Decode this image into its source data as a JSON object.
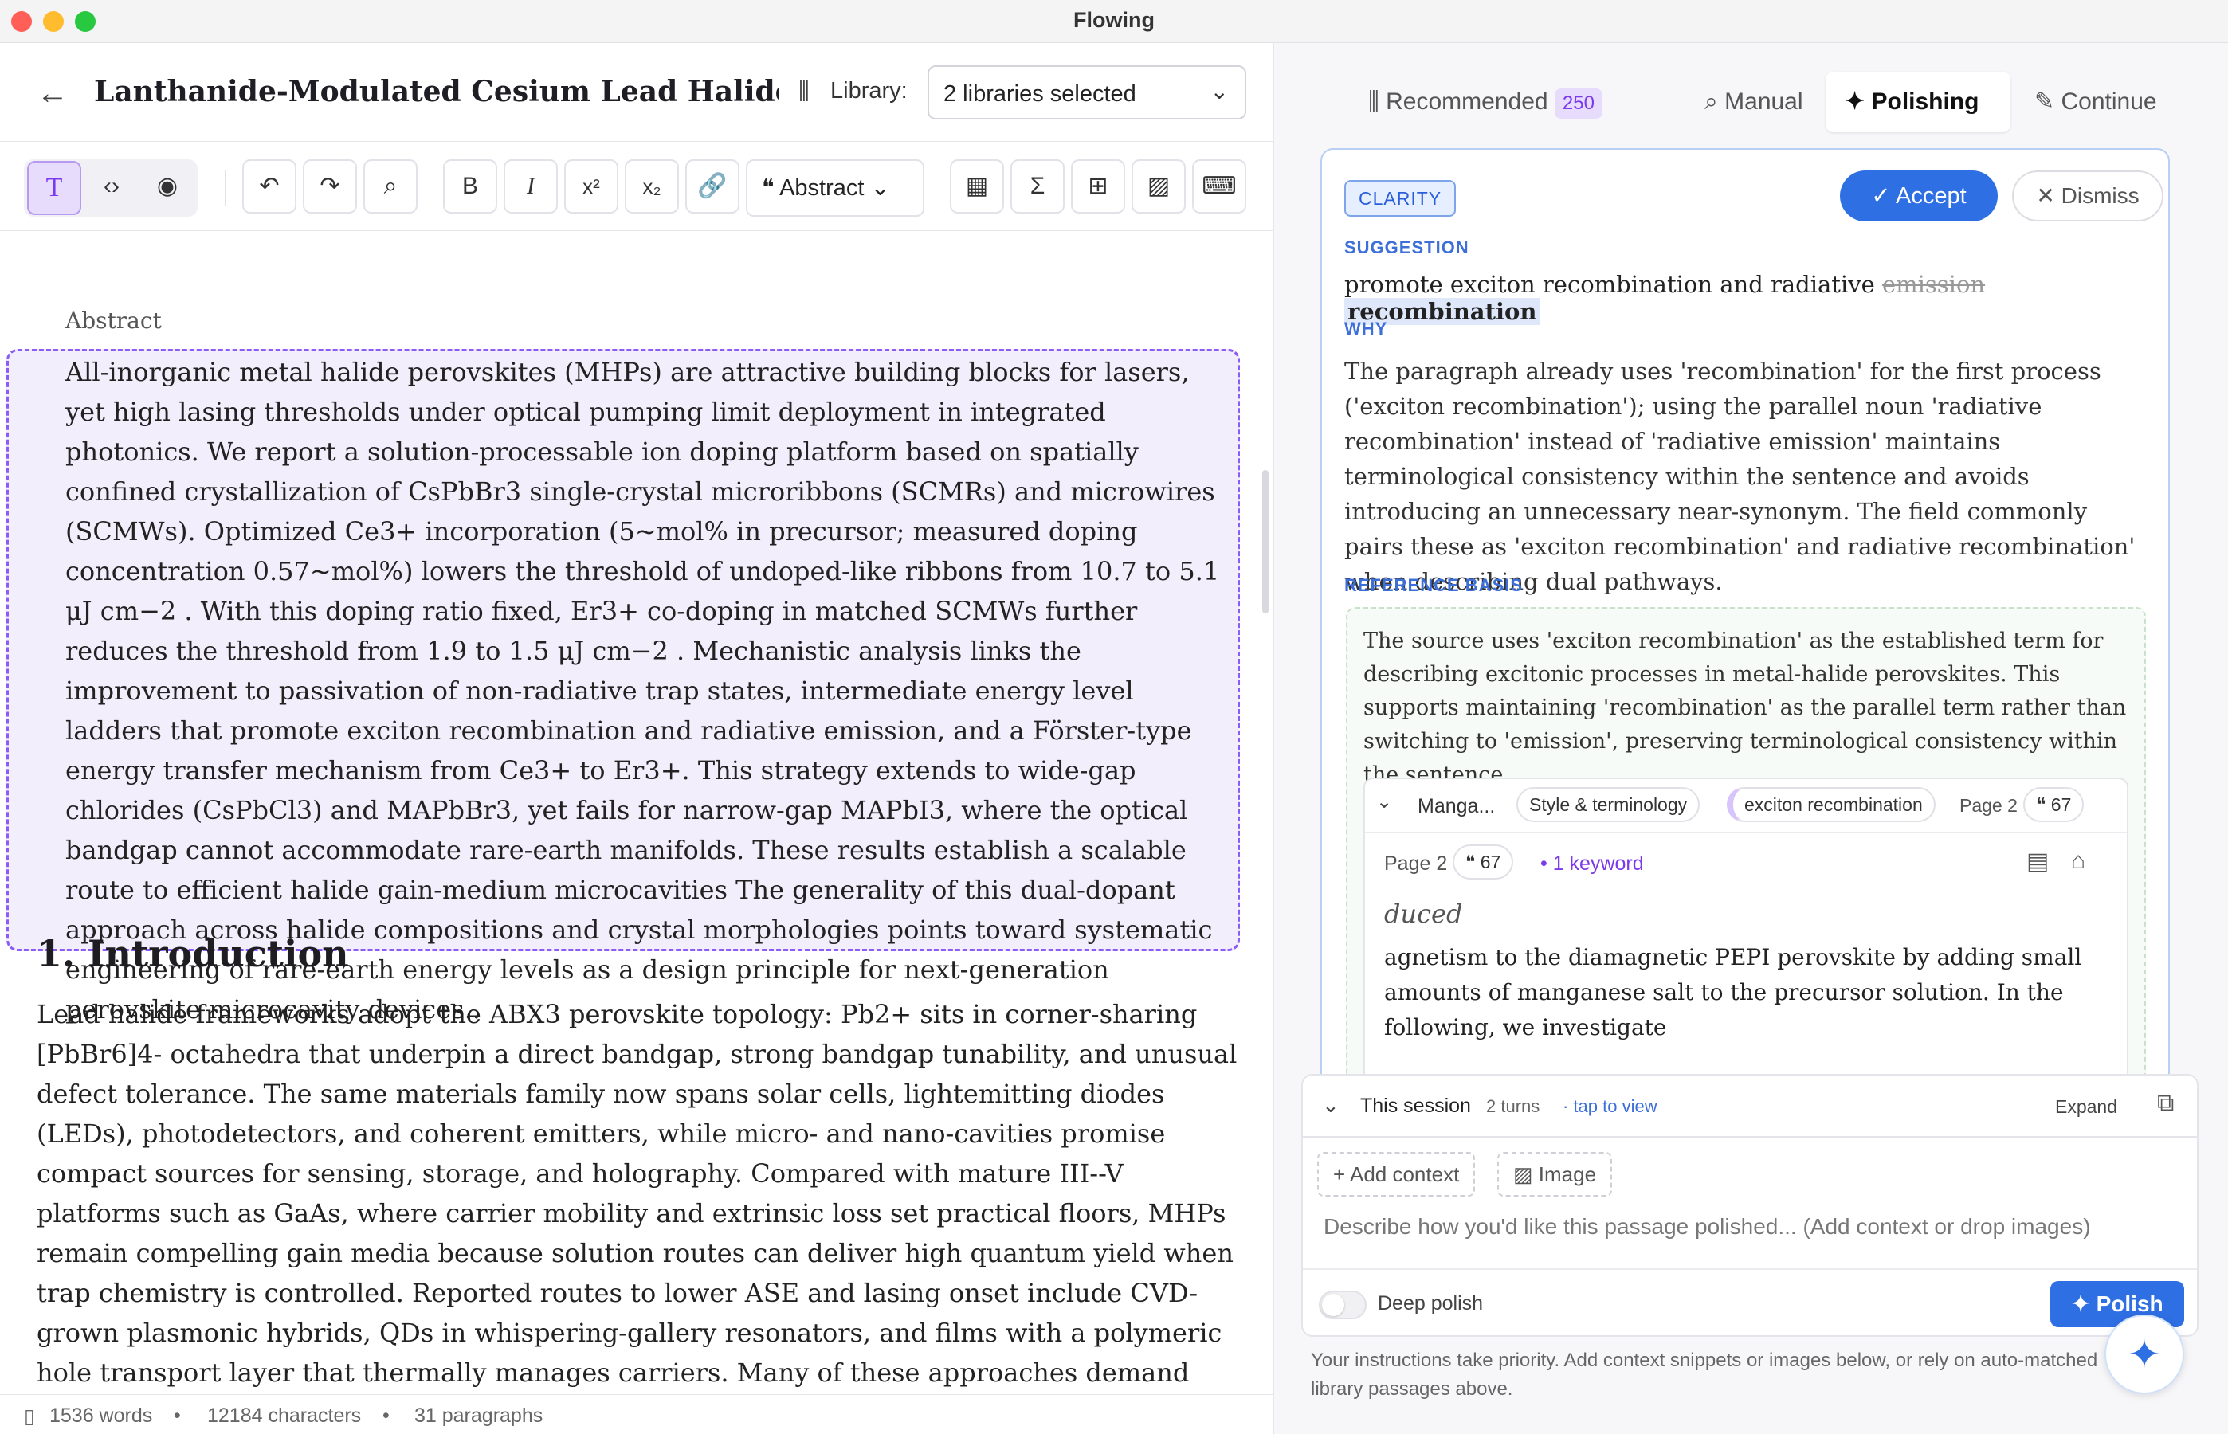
{
  "window": {
    "title": "Flowing"
  },
  "header": {
    "doc_title": "Lanthanide-Modulated Cesium Lead Halide Mic...",
    "library_label": "Library:",
    "library_value": "2 libraries selected"
  },
  "toolbar": {
    "block_type": "Abstract"
  },
  "editor": {
    "abstract_label": "Abstract",
    "abstract_text": "All-inorganic metal halide perovskites (MHPs) are attractive building blocks for lasers, yet high lasing thresholds under optical pumping limit deployment in integrated photonics. We report a solution-processable ion doping platform based on spatially confined crystallization of CsPbBr3 single-crystal microribbons (SCMRs) and microwires (SCMWs). Optimized Ce3+ incorporation (5~mol% in precursor; measured doping concentration 0.57~mol%) lowers the threshold of undoped-like ribbons from 10.7 to 5.1 μJ cm−2 . With this doping ratio fixed, Er3+ co-doping in matched SCMWs further reduces the threshold from 1.9 to 1.5 μJ cm−2 . Mechanistic analysis links the improvement to passivation of non-radiative trap states, intermediate energy level ladders that promote exciton recombination and radiative emission, and a Förster-type energy transfer mechanism from Ce3+ to Er3+. This strategy extends to wide-gap chlorides (CsPbCl3) and MAPbBr3, yet fails for narrow-gap MAPbI3, where the optical bandgap cannot accommodate rare-earth manifolds. These results establish a scalable route to efficient halide gain-medium microcavities The generality of this dual-dopant approach across halide compositions and crystal morphologies points toward systematic engineering of rare-earth energy levels as a design principle for next-generation perovskite microcavity devices..",
    "intro_heading": "1. Introduction",
    "intro_text": "Lead halide frameworks adopt the ABX3 perovskite topology: Pb2+ sits in corner-sharing [PbBr6]4- octahedra that underpin a direct bandgap, strong bandgap tunability, and unusual defect tolerance. The same materials family now spans solar cells, lightemitting diodes (LEDs), photodetectors, and coherent emitters, while micro- and nano-cavities promise compact sources for sensing, storage, and holography. Compared with mature III--V platforms such as GaAs, where carrier mobility and extrinsic loss set practical floors, MHPs remain compelling gain media because solution routes can deliver high quantum yield when trap chemistry is controlled. Reported routes to lower ASE and lasing onset include CVD-grown plasmonic hybrids, QDs in whispering-gallery resonators, and films with a polymeric hole transport layer that thermally manages carriers. Many of these approaches demand elaborate microfabrication. Rare-earth ions"
  },
  "status": {
    "words": "1536 words",
    "characters": "12184 characters",
    "paragraphs": "31 paragraphs"
  },
  "panel": {
    "tabs": {
      "recommended": "Recommended",
      "recommended_count": "250",
      "manual": "Manual",
      "polishing": "Polishing",
      "continue": "Continue"
    },
    "card": {
      "category": "CLARITY",
      "accept": "Accept",
      "dismiss": "Dismiss",
      "suggestion_label": "SUGGESTION",
      "suggestion_prefix": "promote exciton recombination and radiative",
      "suggestion_removed": "emission",
      "suggestion_added": "recombination",
      "why_label": "WHY",
      "why_text": "The paragraph already uses 'recombination' for the first process ('exciton recombination'); using the parallel noun 'radiative recombination' instead of 'radiative emission' maintains terminological consistency within the sentence and avoids introducing an unnecessary near-synonym. The field commonly pairs these as 'exciton recombination' and radiative recombination' when describing dual pathways.",
      "ref_label": "REFERENCE BASIS",
      "ref_text": "The source uses 'exciton recombination' as the established term for describing excitonic processes in metal-halide perovskites. This supports maintaining 'recombination' as the parallel term rather than switching to 'emission', preserving terminological consistency within the sentence.",
      "source": {
        "name": "Manga...",
        "category": "Style & terminology",
        "keyword_tag": "exciton recombination",
        "page": "Page 2",
        "quotes": "67",
        "keywords": "1 keyword",
        "excerpt_head": "duced",
        "excerpt": "agnetism to the diamagnetic PEPI perovskite by adding small amounts of manganese salt to the precursor solution. In the following, we investigate"
      }
    },
    "session": {
      "label": "This session",
      "turns": "2 turns",
      "view": "· tap to view",
      "expand": "Expand"
    },
    "input": {
      "add_context": "Add context",
      "image": "Image",
      "placeholder": "Describe how you'd like this passage polished... (Add context or drop images)",
      "deep_polish": "Deep polish",
      "polish": "Polish"
    },
    "footer": "Your instructions take priority. Add context snippets or images below, or rely on auto-matched library passages above."
  }
}
